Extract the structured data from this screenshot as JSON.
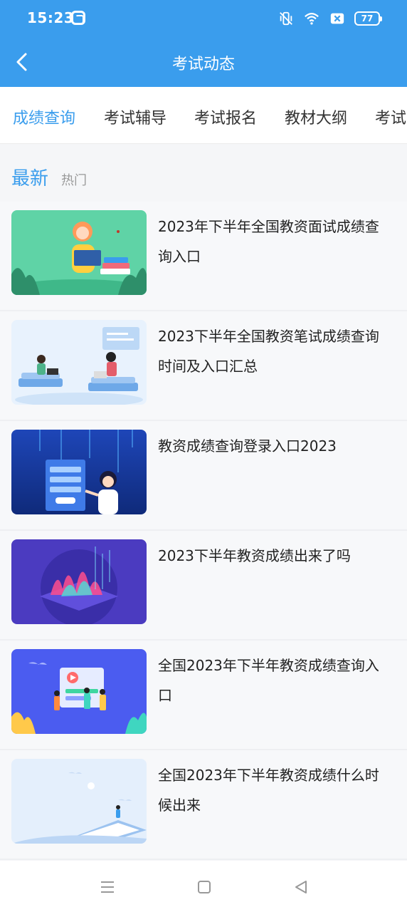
{
  "status_bar": {
    "time": "15:23",
    "battery": "77",
    "icons": [
      "app-notification-icon",
      "mute-vibrate-icon",
      "wifi-icon",
      "sim-off-icon",
      "battery-icon"
    ]
  },
  "header": {
    "title": "考试动态",
    "back_icon": "back-arrow-icon"
  },
  "tabs": [
    {
      "label": "成绩查询",
      "active": true
    },
    {
      "label": "考试辅导",
      "active": false
    },
    {
      "label": "考试报名",
      "active": false
    },
    {
      "label": "教材大纲",
      "active": false
    },
    {
      "label": "考试",
      "active": false
    }
  ],
  "sort": {
    "latest": "最新",
    "hot": "热门"
  },
  "articles": [
    {
      "title": "2023年下半年全国教资面试成绩查询入口",
      "thumbnail": "woman-reading-book-illustration"
    },
    {
      "title": "2023下半年全国教资笔试成绩查询时间及入口汇总",
      "thumbnail": "people-with-laptops-on-books-illustration"
    },
    {
      "title": "教资成绩查询登录入口2023",
      "thumbnail": "woman-with-login-screen-illustration"
    },
    {
      "title": "2023下半年教资成绩出来了吗",
      "thumbnail": "data-chart-platform-illustration"
    },
    {
      "title": "全国2023年下半年教资成绩查询入口",
      "thumbnail": "people-with-video-board-illustration"
    },
    {
      "title": "全国2023年下半年教资成绩什么时候出来",
      "thumbnail": "person-on-open-book-illustration"
    }
  ],
  "bottom_nav": {
    "icons": [
      "menu-icon",
      "home-square-icon",
      "back-triangle-icon"
    ]
  },
  "colors": {
    "primary": "#3a9ded",
    "page_bg": "#f5f6f8",
    "text": "#222222",
    "muted": "#999999"
  }
}
